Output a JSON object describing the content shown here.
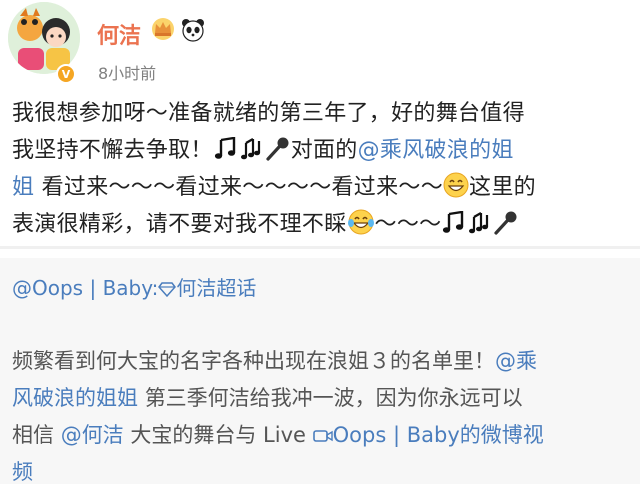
{
  "post": {
    "username": "何洁",
    "timestamp": "8小时前",
    "line1": "我很想参加呀～准备就绪的第三年了，好的舞台值得",
    "line2_a": "我坚持不懈去争取！",
    "line2_b": "对面的",
    "line2_link": "@乘风破浪的姐",
    "line3_link": "姐",
    "line3_a": "看过来～～～看过来～～～～看过来～～",
    "line3_b": "这里的",
    "line4_a": "表演很精彩，请不要对我不理不睬",
    "line4_b": "～～～"
  },
  "repost": {
    "author_a": "@Oops",
    "author_sep": "|",
    "author_b": "Baby:",
    "author_c": "何洁超话",
    "line1_a": "频繁看到何大宝的名字各种出现在浪姐３的名单里！",
    "line1_link": "@乘",
    "line2_link": "风破浪的姐姐",
    "line2_a": "第三季何洁给我冲一波，因为你永远可以",
    "line3_a": "相信",
    "line3_link1": "@何洁",
    "line3_b": "大宝的舞台与 Live",
    "line3_link2": "Oops",
    "line3_sep": "|",
    "line3_link3": "Baby的微博视",
    "line4_link": "频"
  },
  "icons": {
    "music": "music-note-icon",
    "mic": "microphone-icon",
    "smile": "grin-emoji-icon",
    "laugh": "laugh-cry-emoji-icon",
    "crown": "crown-badge-icon",
    "panda": "panda-icon",
    "video": "video-camera-icon",
    "supertopic": "diamond-icon"
  },
  "colors": {
    "username": "#eb7350",
    "link": "#4a7dbd",
    "repost_bg": "#f7f7f7"
  }
}
